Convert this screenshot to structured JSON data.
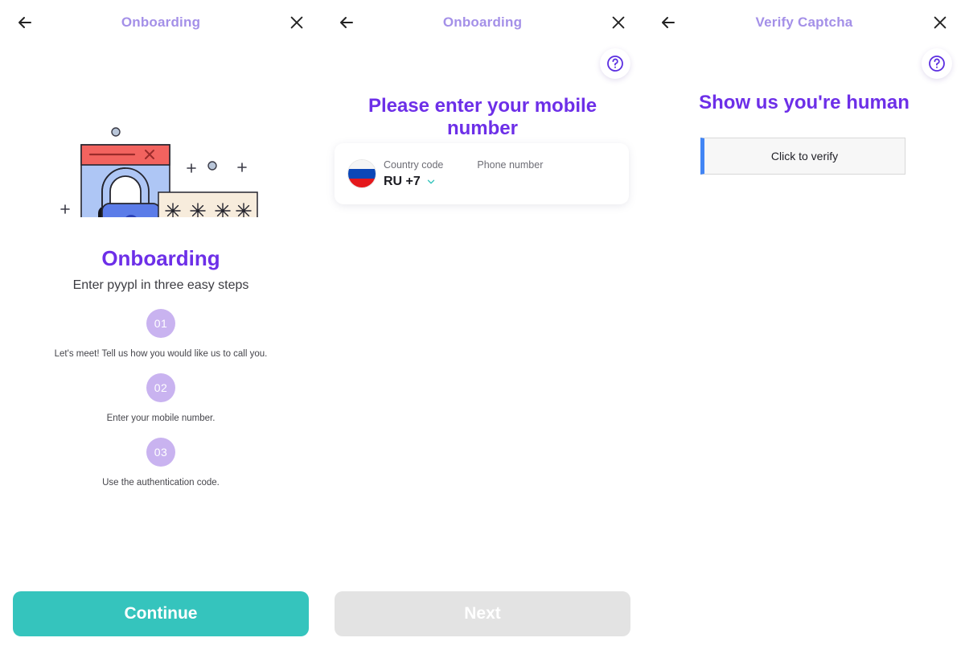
{
  "screens": [
    {
      "header": {
        "title": "Onboarding",
        "back_icon": "arrow-left-icon",
        "close_icon": "close-icon"
      },
      "title": "Onboarding",
      "subtitle": "Enter pyypl in three easy steps",
      "steps": [
        {
          "number": "01",
          "text": "Let's meet! Tell us how you would like us to call you."
        },
        {
          "number": "02",
          "text": "Enter your mobile number."
        },
        {
          "number": "03",
          "text": "Use the authentication code."
        }
      ],
      "cta": "Continue"
    },
    {
      "header": {
        "title": "Onboarding",
        "back_icon": "arrow-left-icon",
        "close_icon": "close-icon"
      },
      "help_icon": "help-circle-icon",
      "heading": "Please enter your mobile number",
      "form": {
        "country_code_label": "Country code",
        "country_code_value": "RU +7",
        "country_flag": "flag-russia-icon",
        "chevron_icon": "chevron-down-icon",
        "phone_label": "Phone number",
        "phone_value": "",
        "phone_placeholder": ""
      },
      "cta": "Next"
    },
    {
      "header": {
        "title": "Verify Captcha",
        "back_icon": "arrow-left-icon",
        "close_icon": "close-icon"
      },
      "help_icon": "help-circle-icon",
      "heading": "Show us you're human",
      "captcha_label": "Click to verify"
    }
  ],
  "colors": {
    "accent_purple": "#6d2fe8",
    "header_purple": "#a490e8",
    "step_badge": "#c9b3f0",
    "primary_button": "#35c4bd",
    "disabled_button": "#e3e3e3",
    "captcha_accent": "#4285f4"
  }
}
